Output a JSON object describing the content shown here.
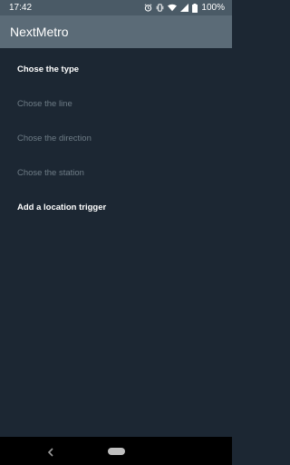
{
  "status_bar": {
    "time": "17:42",
    "battery_percent": "100%",
    "icons": [
      "alarm-icon",
      "vibrate-icon",
      "wifi-icon",
      "signal-icon",
      "battery-icon"
    ]
  },
  "app_bar": {
    "title": "NextMetro"
  },
  "menu": {
    "items": [
      {
        "label": "Chose the type",
        "enabled": true
      },
      {
        "label": "Chose the line",
        "enabled": false
      },
      {
        "label": "Chose the direction",
        "enabled": false
      },
      {
        "label": "Chose the station",
        "enabled": false
      },
      {
        "label": "Add a location trigger",
        "enabled": true
      }
    ]
  },
  "navigation_bar": {
    "icons": [
      "back-icon",
      "home-icon"
    ]
  },
  "colors": {
    "status_bar": "#4a5a66",
    "app_bar": "#5b6b77",
    "background": "#1c2733",
    "text_enabled": "#ffffff",
    "text_disabled": "#6e7c86"
  }
}
